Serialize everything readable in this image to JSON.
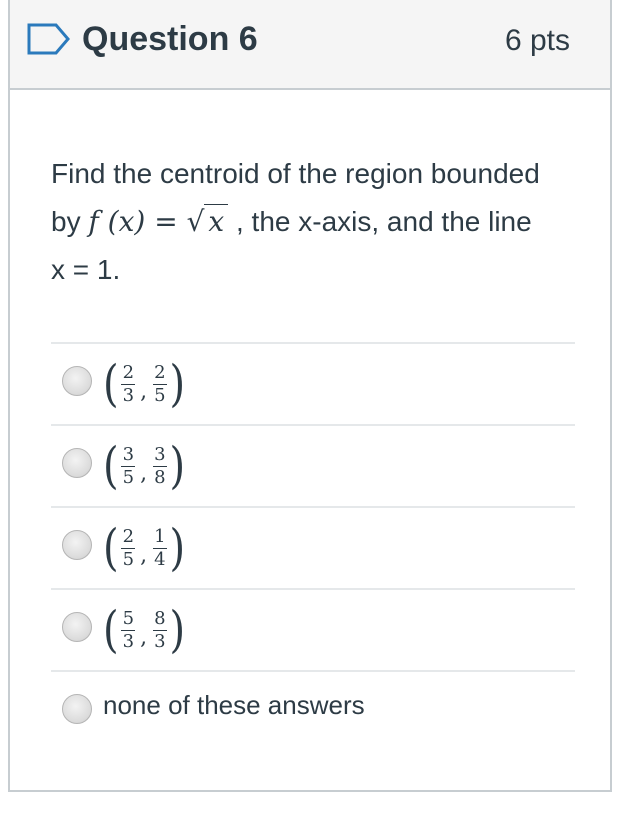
{
  "question": {
    "title": "Question 6",
    "points": "6 pts",
    "text_before": "Find the centroid of the region bounded by ",
    "func_f": "f",
    "func_arg": "(x)",
    "equals": "=",
    "sqrt_arg": "x",
    "text_after": " , the x-axis, and the line x = 1."
  },
  "answers": [
    {
      "a_num": "2",
      "a_den": "3",
      "b_num": "2",
      "b_den": "5"
    },
    {
      "a_num": "3",
      "a_den": "5",
      "b_num": "3",
      "b_den": "8"
    },
    {
      "a_num": "2",
      "a_den": "5",
      "b_num": "1",
      "b_den": "4"
    },
    {
      "a_num": "5",
      "a_den": "3",
      "b_num": "8",
      "b_den": "3"
    }
  ],
  "none_option": "none of these answers",
  "colors": {
    "header_bg": "#f5f5f5",
    "border": "#c7cdd1",
    "text": "#2d3b45",
    "flag": "#2b7abc"
  },
  "icons": {
    "flag": "bookmark-flag-icon"
  }
}
